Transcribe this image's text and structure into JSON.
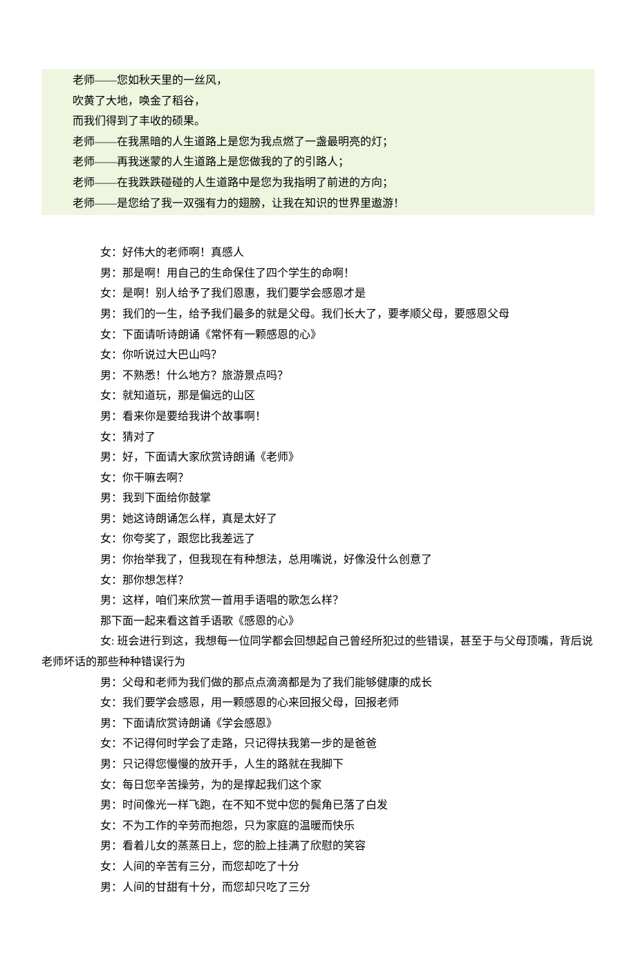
{
  "poem": {
    "lines": [
      "老师——您如秋天里的一丝风，",
      "吹黄了大地，唤金了稻谷，",
      "而我们得到了丰收的硕果。",
      "老师——在我黑暗的人生道路上是您为我点燃了一盏最明亮的灯；",
      "老师——再我迷蒙的人生道路上是您做我的了的引路人；",
      "老师——在我跌跌碰碰的人生道路中是您为我指明了前进的方向；",
      "老师——是您给了我一双强有力的翅膀，让我在知识的世界里遨游！"
    ]
  },
  "dialogue": {
    "lines": [
      {
        "type": "normal",
        "text": "女：好伟大的老师啊！真感人"
      },
      {
        "type": "normal",
        "text": "男：那是啊！用自己的生命保住了四个学生的命啊！"
      },
      {
        "type": "normal",
        "text": "女：是啊！别人给予了我们恩惠，我们要学会感恩才是"
      },
      {
        "type": "normal",
        "text": "男：我们的一生，给予我们最多的就是父母。我们长大了，要孝顺父母，要感恩父母"
      },
      {
        "type": "normal",
        "text": "女：下面请听诗朗诵《常怀有一颗感恩的心》"
      },
      {
        "type": "normal",
        "text": "女：你听说过大巴山吗？"
      },
      {
        "type": "normal",
        "text": "男：不熟悉！什么地方？旅游景点吗？"
      },
      {
        "type": "normal",
        "text": "女：就知道玩，那是偏远的山区"
      },
      {
        "type": "normal",
        "text": "男：看来你是要给我讲个故事啊！"
      },
      {
        "type": "normal",
        "text": "女：猜对了"
      },
      {
        "type": "normal",
        "text": "男：好，下面请大家欣赏诗朗诵《老师》"
      },
      {
        "type": "normal",
        "text": "女：你干嘛去啊？"
      },
      {
        "type": "normal",
        "text": "男：我到下面给你鼓掌"
      },
      {
        "type": "normal",
        "text": "男：她这诗朗诵怎么样，真是太好了"
      },
      {
        "type": "normal",
        "text": "女：你夸奖了，跟您比我差远了"
      },
      {
        "type": "normal",
        "text": "男：你抬举我了，但我现在有种想法，总用嘴说，好像没什么创意了"
      },
      {
        "type": "normal",
        "text": "女：那你想怎样？"
      },
      {
        "type": "normal",
        "text": "男：这样，咱们来欣赏一首用手语唱的歌怎么样？"
      },
      {
        "type": "narrative",
        "text": "那下面一起来看这首手语歌《感恩的心》"
      },
      {
        "type": "hanging",
        "text": "女: 班会进行到这，我想每一位同学都会回想起自己曾经所犯过的些错误，甚至于与父母顶嘴，背后说老师坏话的那些种种错误行为"
      },
      {
        "type": "normal",
        "text": "男：父母和老师为我们做的那点点滴滴都是为了我们能够健康的成长"
      },
      {
        "type": "normal",
        "text": "女：我们要学会感恩，用一颗感恩的心来回报父母，回报老师"
      },
      {
        "type": "normal",
        "text": "男：下面请欣赏诗朗诵《学会感恩》"
      },
      {
        "type": "normal",
        "text": "女：不记得何时学会了走路，只记得扶我第一步的是爸爸"
      },
      {
        "type": "normal",
        "text": "男：只记得您慢慢的放开手，人生的路就在我脚下"
      },
      {
        "type": "normal",
        "text": "女：每日您辛苦操劳，为的是撑起我们这个家"
      },
      {
        "type": "normal",
        "text": "男：时间像光一样飞跑，在不知不觉中您的鬓角已落了白发"
      },
      {
        "type": "normal",
        "text": "女：不为工作的辛劳而抱怨，只为家庭的温暖而快乐"
      },
      {
        "type": "normal",
        "text": "男：看着儿女的蒸蒸日上，您的脸上挂满了欣慰的笑容"
      },
      {
        "type": "normal",
        "text": "女：人间的辛苦有三分，而您却吃了十分"
      },
      {
        "type": "normal",
        "text": "男：人间的甘甜有十分，而您却只吃了三分"
      }
    ]
  }
}
